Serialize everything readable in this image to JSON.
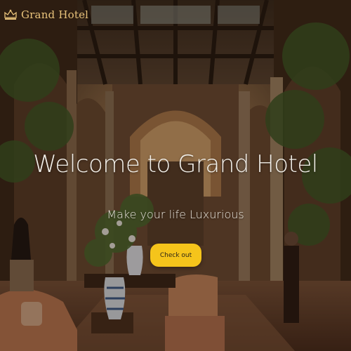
{
  "brand": {
    "name": "Grand Hotel",
    "logo_icon": "crown-hotel-icon",
    "accent": "#e8c27a"
  },
  "hero": {
    "title": "Welcome to Grand Hotel",
    "subtitle": "Make your life Luxurious",
    "cta_label": "Check out",
    "cta_color": "#f5c41b",
    "background": "hotel-lobby-photo"
  }
}
